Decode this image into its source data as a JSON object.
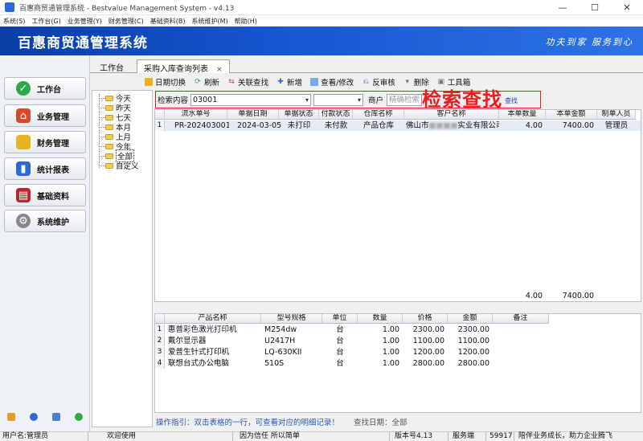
{
  "window": {
    "title": "百惠商贸通管理系统 - Bestvalue Management System - v4.13",
    "controls": {
      "minimize": "—",
      "maximize": "☐",
      "close": "✕"
    }
  },
  "menu": [
    "系统(S)",
    "工作台(G)",
    "业务管理(Y)",
    "财务管理(C)",
    "基础资料(B)",
    "系统维护(M)",
    "帮助(H)"
  ],
  "banner": {
    "title": "百惠商贸通管理系统",
    "slogan": "功夫到家 服务到心"
  },
  "nav": [
    {
      "label": "工作台",
      "icon": "check-icon",
      "color": "#2ea84a"
    },
    {
      "label": "业务管理",
      "icon": "house-icon",
      "color": "#d9482b"
    },
    {
      "label": "财务管理",
      "icon": "folder-icon",
      "color": "#e6b423"
    },
    {
      "label": "统计报表",
      "icon": "chart-icon",
      "color": "#2d6ad8"
    },
    {
      "label": "基础资料",
      "icon": "book-icon",
      "color": "#c0242a"
    },
    {
      "label": "系统维护",
      "icon": "gear-icon",
      "color": "#888888"
    }
  ],
  "tabs": [
    {
      "label": "工作台"
    },
    {
      "label": "采购入库查询列表",
      "close": "×"
    }
  ],
  "toolbar": [
    "日期切换",
    "刷新",
    "关联查找",
    "新增",
    "查看/修改",
    "反审核",
    "删除",
    "工具箱"
  ],
  "tree": [
    "今天",
    "昨天",
    "七天",
    "本月",
    "上月",
    "今年",
    "全部",
    "自定义"
  ],
  "tree_selected": "全部",
  "search": {
    "label": "检索内容",
    "value": "03001",
    "merchant_label": "商户",
    "merchant_placeholder": "精确检索",
    "button": "查找"
  },
  "annotation": "检索查找",
  "orders": {
    "columns": [
      "流水单号",
      "单据日期",
      "单据状态",
      "付款状态",
      "仓库名称",
      "客户名称",
      "本单数量",
      "本单金额",
      "制单人员"
    ],
    "rows": [
      {
        "no": "1",
        "serial": "PR-202403001",
        "date": "2024-03-05",
        "status": "未打印",
        "pay": "未付款",
        "warehouse": "产品仓库",
        "customer_a": "佛山市",
        "customer_b": "实业有限公司",
        "qty": "4.00",
        "amount": "7400.00",
        "maker": "管理员"
      }
    ],
    "total_qty": "4.00",
    "total_amount": "7400.00"
  },
  "items": {
    "columns": [
      "产品名称",
      "型号规格",
      "单位",
      "数量",
      "价格",
      "金额",
      "备注"
    ],
    "rows": [
      {
        "no": "1",
        "name": "惠普彩色激光打印机",
        "model": "M254dw",
        "unit": "台",
        "qty": "1.00",
        "price": "2300.00",
        "amount": "2300.00"
      },
      {
        "no": "2",
        "name": "戴尔显示器",
        "model": "U2417H",
        "unit": "台",
        "qty": "1.00",
        "price": "1100.00",
        "amount": "1100.00"
      },
      {
        "no": "3",
        "name": "爱普生针式打印机",
        "model": "LQ-630KII",
        "unit": "台",
        "qty": "1.00",
        "price": "1200.00",
        "amount": "1200.00"
      },
      {
        "no": "4",
        "name": "联想台式办公电脑",
        "model": "510S",
        "unit": "台",
        "qty": "1.00",
        "price": "2800.00",
        "amount": "2800.00"
      }
    ]
  },
  "hint": "操作指引：双击表格的一行，可查看对应的明细记录！",
  "find_date": "查找日期：全部",
  "status": {
    "user": "用户名:管理员",
    "welcome": "欢迎使用",
    "motto": "因为信任 所以简单",
    "version": "版本号4.13",
    "service_label": "服务端",
    "service_port": "59917",
    "slogan": "陪伴业务成长，助力企业腾飞"
  }
}
